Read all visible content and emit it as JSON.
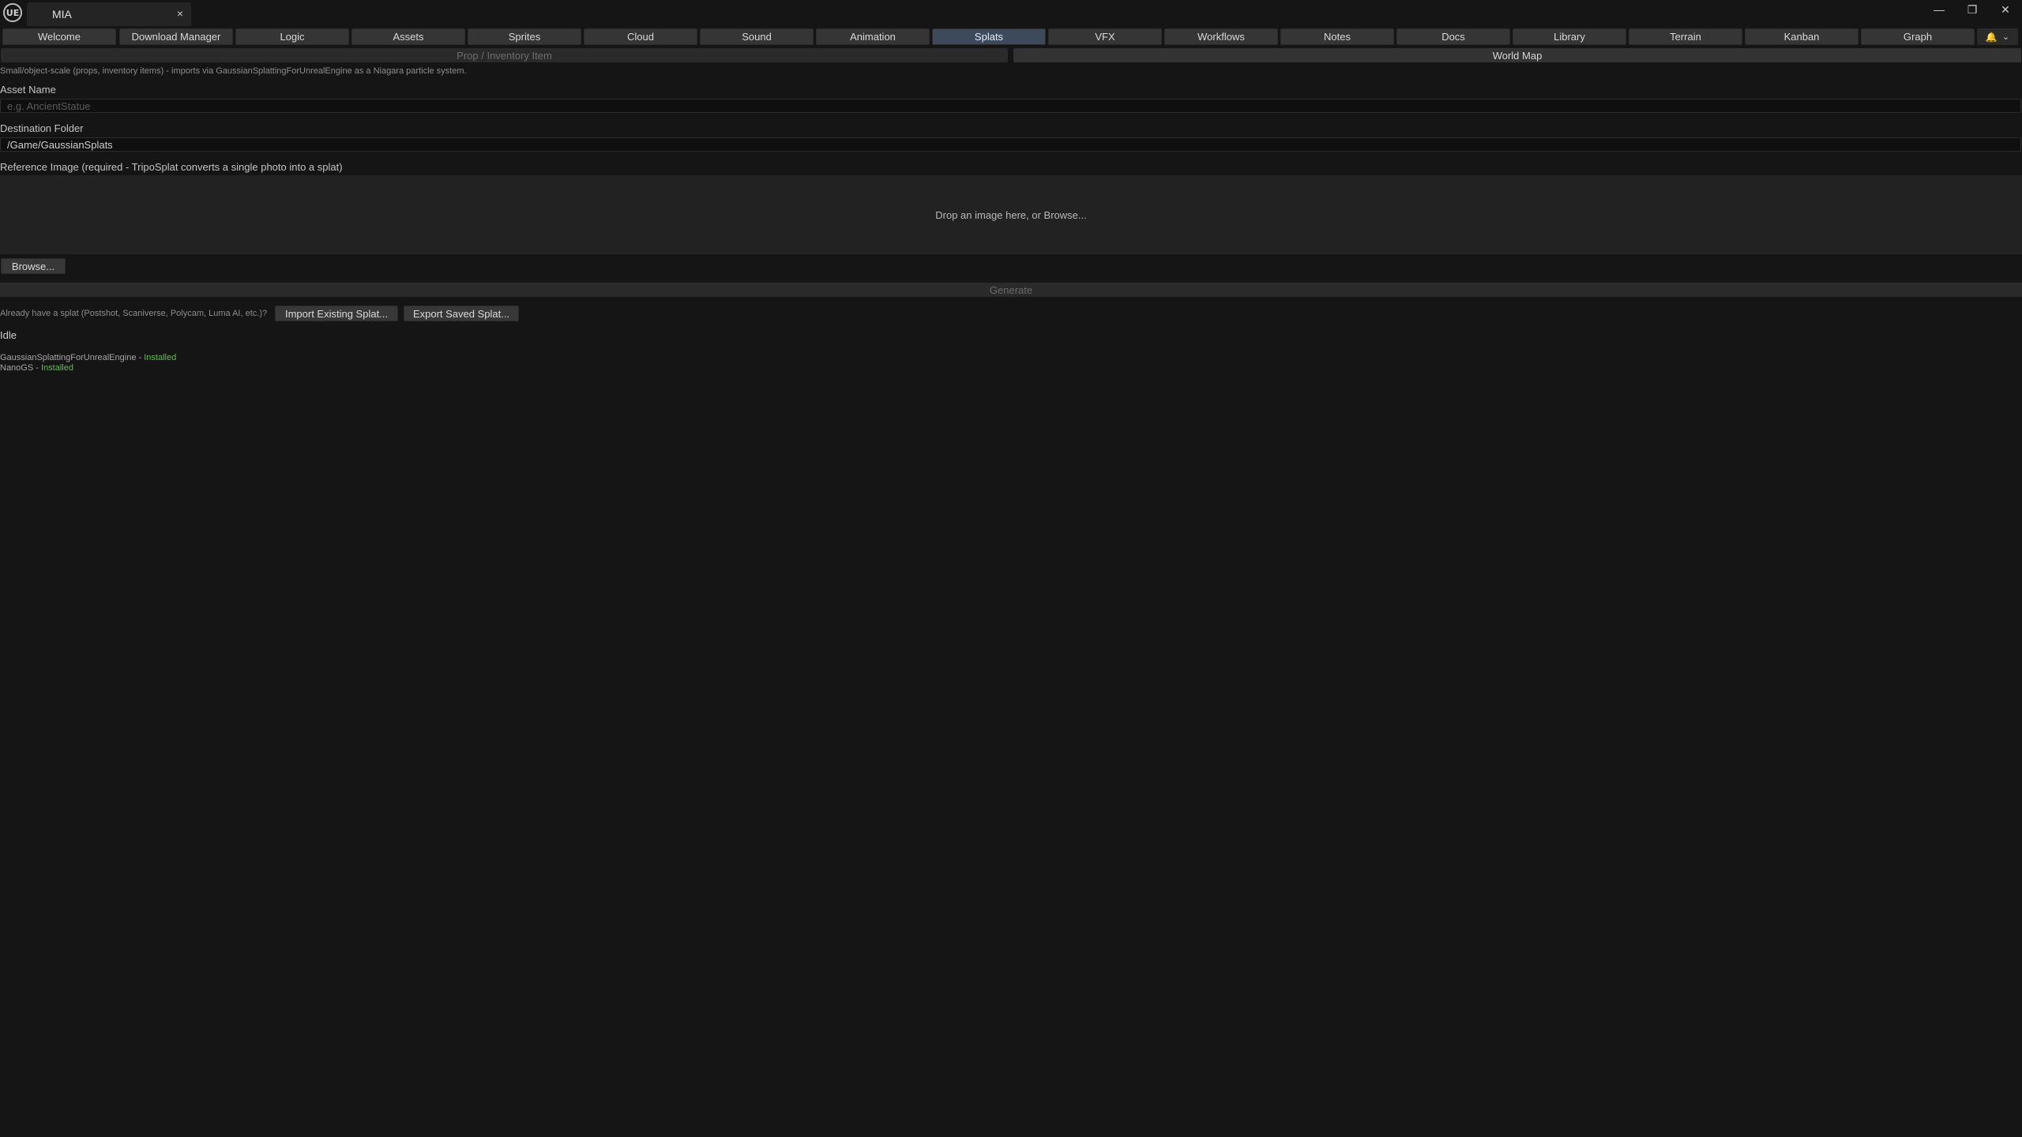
{
  "window": {
    "logo_text": "UE",
    "tab_title": "MIA",
    "tab_close": "×",
    "controls": {
      "minimize": "—",
      "restore": "❐",
      "close": "✕"
    }
  },
  "tabs": [
    {
      "label": "Welcome",
      "active": false
    },
    {
      "label": "Download Manager",
      "active": false
    },
    {
      "label": "Logic",
      "active": false
    },
    {
      "label": "Assets",
      "active": false
    },
    {
      "label": "Sprites",
      "active": false
    },
    {
      "label": "Cloud",
      "active": false
    },
    {
      "label": "Sound",
      "active": false
    },
    {
      "label": "Animation",
      "active": false
    },
    {
      "label": "Splats",
      "active": true
    },
    {
      "label": "VFX",
      "active": false
    },
    {
      "label": "Workflows",
      "active": false
    },
    {
      "label": "Notes",
      "active": false
    },
    {
      "label": "Docs",
      "active": false
    },
    {
      "label": "Library",
      "active": false
    },
    {
      "label": "Terrain",
      "active": false
    },
    {
      "label": "Kanban",
      "active": false
    },
    {
      "label": "Graph",
      "active": false
    }
  ],
  "notifications": {
    "icon": "🔔",
    "chevron": "⌄"
  },
  "modes": {
    "prop": "Prop / Inventory Item",
    "world": "World Map"
  },
  "description": "Small/object-scale (props, inventory items) - imports via GaussianSplattingForUnrealEngine as a Niagara particle system.",
  "asset_name": {
    "label": "Asset Name",
    "placeholder": "e.g. AncientStatue"
  },
  "destination": {
    "label": "Destination Folder",
    "value": "/Game/GaussianSplats"
  },
  "reference": {
    "label": "Reference Image (required - TripoSplat converts a single photo into a splat)",
    "drop_text": "Drop an image here, or Browse...",
    "browse": "Browse..."
  },
  "generate": "Generate",
  "existing": {
    "prompt": "Already have a splat (Postshot, Scaniverse, Polycam, Luma AI, etc.)?",
    "import": "Import Existing Splat...",
    "export": "Export Saved Splat..."
  },
  "status": "Idle",
  "plugins": [
    {
      "name": "GaussianSplattingForUnrealEngine",
      "sep": " - ",
      "state": "Installed"
    },
    {
      "name": "NanoGS",
      "sep": " - ",
      "state": "Installed"
    }
  ]
}
